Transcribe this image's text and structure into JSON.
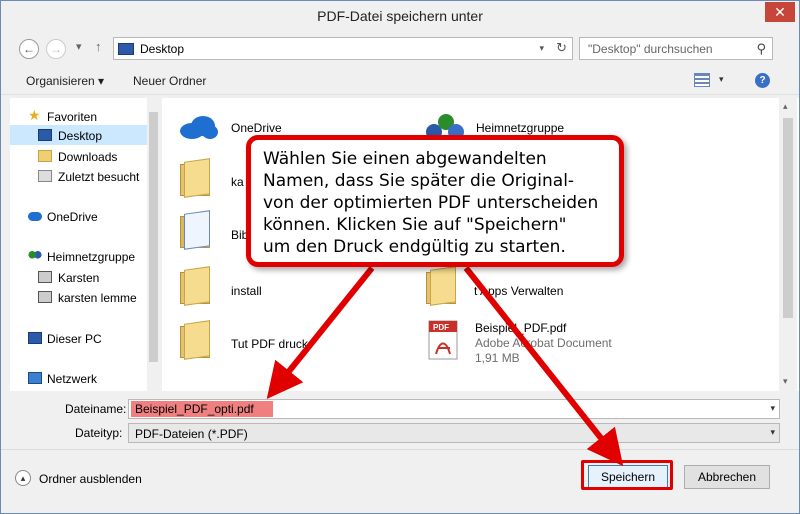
{
  "window": {
    "title": "PDF-Datei speichern unter",
    "close_glyph": "✕"
  },
  "nav": {
    "back_glyph": "←",
    "forward_glyph": "→",
    "up_glyph": "↑",
    "address": "Desktop",
    "address_dd_glyph": "▾",
    "refresh_glyph": "↻",
    "search_placeholder": "\"Desktop\" durchsuchen",
    "search_glyph": "⚲"
  },
  "toolbar": {
    "organize": "Organisieren ▾",
    "new_folder": "Neuer Ordner",
    "view_dd_glyph": "▾",
    "help_glyph": "?"
  },
  "sidebar": {
    "items": [
      {
        "label": "Favoriten",
        "icon": "star-icon"
      },
      {
        "label": "Desktop",
        "icon": "desktop-icon",
        "selected": true
      },
      {
        "label": "Downloads",
        "icon": "downloads-icon"
      },
      {
        "label": "Zuletzt besucht",
        "icon": "recent-icon"
      },
      {
        "label": "OneDrive",
        "icon": "onedrive-icon"
      },
      {
        "label": "Heimnetzgruppe",
        "icon": "homegroup-icon"
      },
      {
        "label": "Karsten",
        "icon": "user-icon"
      },
      {
        "label": "karsten lemme",
        "icon": "user-icon"
      },
      {
        "label": "Dieser PC",
        "icon": "pc-icon"
      },
      {
        "label": "Netzwerk",
        "icon": "network-icon"
      }
    ]
  },
  "files": [
    {
      "name": "OneDrive",
      "icon": "onedrive-icon"
    },
    {
      "name": "Heimnetzgruppe",
      "icon": "homegroup-icon"
    },
    {
      "name": "ka",
      "icon": "user-folder-icon"
    },
    {
      "name": "Bib",
      "icon": "library-icon"
    },
    {
      "name": "install",
      "icon": "folder-icon"
    },
    {
      "name": "t Apps Verwalten",
      "icon": "folder-icon"
    },
    {
      "name": "Tut PDF druck",
      "icon": "folder-icon"
    },
    {
      "name": "Beispiel_PDF.pdf",
      "icon": "pdf-icon",
      "type": "Adobe Acrobat Document",
      "size": "1,91 MB"
    }
  ],
  "form": {
    "filename_label": "Dateiname:",
    "filename_value": "Beispiel_PDF_opti.pdf",
    "filetype_label": "Dateityp:",
    "filetype_value": "PDF-Dateien (*.PDF)",
    "dd_glyph": "▾"
  },
  "footer": {
    "hide_folders": "Ordner ausblenden",
    "hide_glyph": "▴",
    "save": "Speichern",
    "cancel": "Abbrechen"
  },
  "callout": {
    "lines": [
      "Wählen Sie einen abgewandelten",
      "Namen, dass Sie später die Original-",
      "von der optimierten PDF unterscheiden",
      "können. Klicken Sie auf \"Speichern\"",
      "um den Druck endgültig zu starten."
    ]
  },
  "colors": {
    "accent_red": "#e00000",
    "highlight_salmon": "#f08080",
    "selection_blue": "#cce8ff"
  }
}
